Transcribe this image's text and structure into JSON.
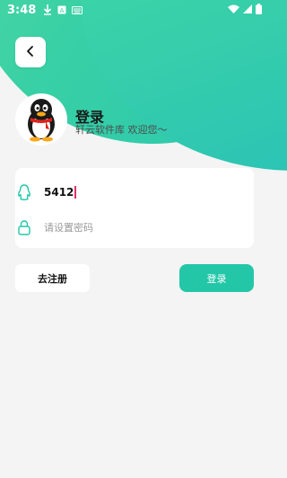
{
  "status_bar": {
    "time": "3:48"
  },
  "header": {
    "title": "登录",
    "subtitle": "轩云软件库 欢迎您～"
  },
  "form": {
    "qq_value": "5412",
    "password_placeholder": "请设置密码"
  },
  "actions": {
    "register_label": "去注册",
    "login_label": "登录"
  },
  "colors": {
    "accent": "#23c7a8",
    "caret": "#e0306e"
  },
  "icons": {
    "back": "chevron-left-icon",
    "account": "qq-penguin-icon",
    "password": "lock-icon"
  }
}
